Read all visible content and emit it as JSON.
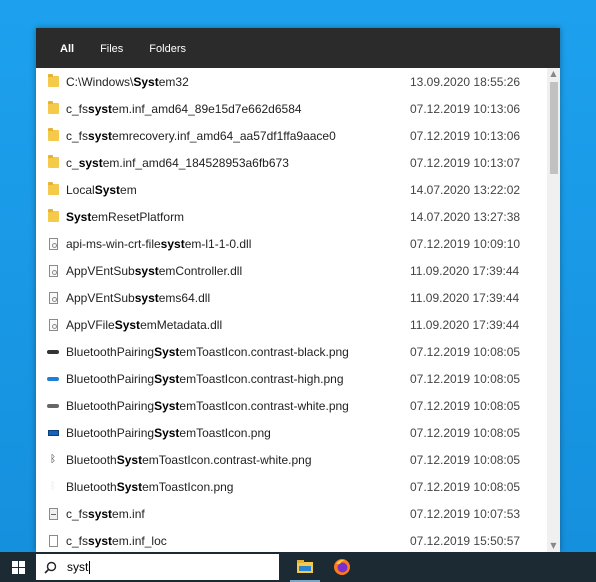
{
  "tabs": [
    {
      "label": "All",
      "active": true
    },
    {
      "label": "Files",
      "active": false
    },
    {
      "label": "Folders",
      "active": false
    }
  ],
  "results": [
    {
      "icon": "folder-icon",
      "parts": [
        [
          "C:\\Windows\\",
          false
        ],
        [
          "Syst",
          true
        ],
        [
          "em32",
          false
        ]
      ],
      "date": "13.09.2020 18:55:26"
    },
    {
      "icon": "folder-icon",
      "parts": [
        [
          "c_fs",
          false
        ],
        [
          "syst",
          true
        ],
        [
          "em.inf_amd64_89e15d7e662d6584",
          false
        ]
      ],
      "date": "07.12.2019 10:13:06"
    },
    {
      "icon": "folder-icon",
      "parts": [
        [
          "c_fs",
          false
        ],
        [
          "syst",
          true
        ],
        [
          "emrecovery.inf_amd64_aa57df1ffa9aace0",
          false
        ]
      ],
      "date": "07.12.2019 10:13:06"
    },
    {
      "icon": "folder-icon",
      "parts": [
        [
          "c_",
          false
        ],
        [
          "syst",
          true
        ],
        [
          "em.inf_amd64_184528953a6fb673",
          false
        ]
      ],
      "date": "07.12.2019 10:13:07"
    },
    {
      "icon": "folder-icon",
      "parts": [
        [
          "Local",
          false
        ],
        [
          "Syst",
          true
        ],
        [
          "em",
          false
        ]
      ],
      "date": "14.07.2020 13:22:02"
    },
    {
      "icon": "folder-icon",
      "parts": [
        [
          "Syst",
          true
        ],
        [
          "emResetPlatform",
          false
        ]
      ],
      "date": "14.07.2020 13:27:38"
    },
    {
      "icon": "dll-file-icon",
      "parts": [
        [
          "api-ms-win-crt-file",
          false
        ],
        [
          "syst",
          true
        ],
        [
          "em-l1-1-0.dll",
          false
        ]
      ],
      "date": "07.12.2019 10:09:10"
    },
    {
      "icon": "dll-file-icon",
      "parts": [
        [
          "AppVEntSub",
          false
        ],
        [
          "syst",
          true
        ],
        [
          "emController.dll",
          false
        ]
      ],
      "date": "11.09.2020 17:39:44"
    },
    {
      "icon": "dll-file-icon",
      "parts": [
        [
          "AppVEntSub",
          false
        ],
        [
          "syst",
          true
        ],
        [
          "ems64.dll",
          false
        ]
      ],
      "date": "11.09.2020 17:39:44"
    },
    {
      "icon": "dll-file-icon",
      "parts": [
        [
          "AppVFile",
          false
        ],
        [
          "Syst",
          true
        ],
        [
          "emMetadata.dll",
          false
        ]
      ],
      "date": "11.09.2020 17:39:44"
    },
    {
      "icon": "png-black-icon",
      "parts": [
        [
          "BluetoothPairing",
          false
        ],
        [
          "Syst",
          true
        ],
        [
          "emToastIcon.contrast-black.png",
          false
        ]
      ],
      "date": "07.12.2019 10:08:05"
    },
    {
      "icon": "png-blue-icon",
      "parts": [
        [
          "BluetoothPairing",
          false
        ],
        [
          "Syst",
          true
        ],
        [
          "emToastIcon.contrast-high.png",
          false
        ]
      ],
      "date": "07.12.2019 10:08:05"
    },
    {
      "icon": "png-white-icon",
      "parts": [
        [
          "BluetoothPairing",
          false
        ],
        [
          "Syst",
          true
        ],
        [
          "emToastIcon.contrast-white.png",
          false
        ]
      ],
      "date": "07.12.2019 10:08:05"
    },
    {
      "icon": "png-card-icon",
      "parts": [
        [
          "BluetoothPairing",
          false
        ],
        [
          "Syst",
          true
        ],
        [
          "emToastIcon.png",
          false
        ]
      ],
      "date": "07.12.2019 10:08:05"
    },
    {
      "icon": "bluetooth-icon",
      "parts": [
        [
          "Bluetooth",
          false
        ],
        [
          "Syst",
          true
        ],
        [
          "emToastIcon.contrast-white.png",
          false
        ]
      ],
      "date": "07.12.2019 10:08:05"
    },
    {
      "icon": "bluetooth-light-icon",
      "parts": [
        [
          "Bluetooth",
          false
        ],
        [
          "Syst",
          true
        ],
        [
          "emToastIcon.png",
          false
        ]
      ],
      "date": "07.12.2019 10:08:05"
    },
    {
      "icon": "inf-file-icon",
      "parts": [
        [
          "c_fs",
          false
        ],
        [
          "syst",
          true
        ],
        [
          "em.inf",
          false
        ]
      ],
      "date": "07.12.2019 10:07:53"
    },
    {
      "icon": "generic-file-icon",
      "parts": [
        [
          "c_fs",
          false
        ],
        [
          "syst",
          true
        ],
        [
          "em.inf_loc",
          false
        ]
      ],
      "date": "07.12.2019 15:50:57"
    }
  ],
  "search": {
    "value": "syst"
  },
  "taskbar": {
    "start_icon": "windows-logo-icon",
    "search_icon": "search-icon",
    "apps": [
      "file-explorer-icon",
      "firefox-icon"
    ]
  },
  "colors": {
    "tabbar": "#2b2b2b",
    "desktop": "#1da1ee",
    "taskbar": "#1c2a34"
  }
}
